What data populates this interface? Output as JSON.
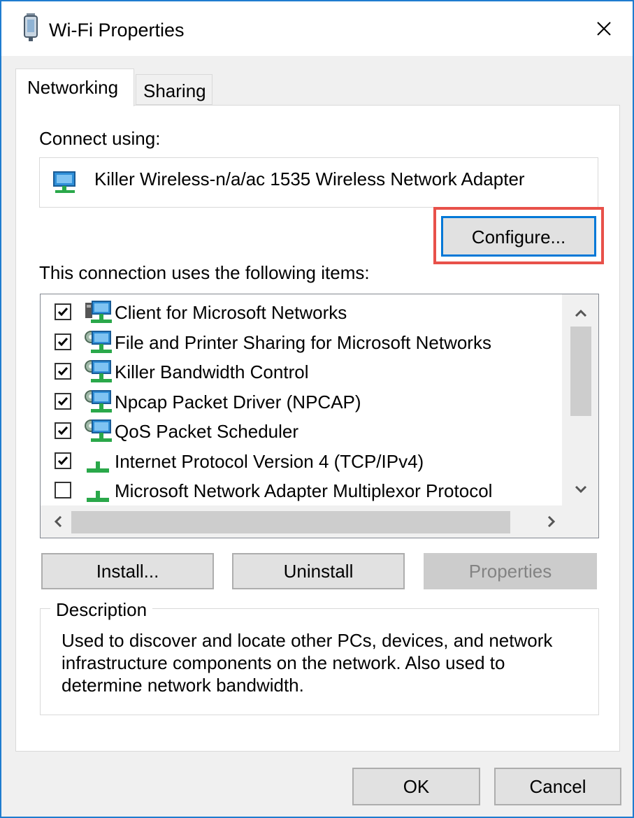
{
  "window": {
    "title": "Wi-Fi Properties"
  },
  "tabs": [
    {
      "label": "Networking",
      "selected": true
    },
    {
      "label": "Sharing",
      "selected": false
    }
  ],
  "connect_using": {
    "label": "Connect using:",
    "adapter": "Killer Wireless-n/a/ac 1535 Wireless Network Adapter",
    "configure_label": "Configure..."
  },
  "items": {
    "label": "This connection uses the following items:",
    "list": [
      {
        "label": "Client for Microsoft Networks",
        "checked": true,
        "icon": "network-client-icon"
      },
      {
        "label": "File and Printer Sharing for Microsoft Networks",
        "checked": true,
        "icon": "network-service-icon"
      },
      {
        "label": "Killer Bandwidth Control",
        "checked": true,
        "icon": "network-service-icon"
      },
      {
        "label": "Npcap Packet Driver (NPCAP)",
        "checked": true,
        "icon": "network-service-icon"
      },
      {
        "label": "QoS Packet Scheduler",
        "checked": true,
        "icon": "network-service-icon"
      },
      {
        "label": "Internet Protocol Version 4 (TCP/IPv4)",
        "checked": true,
        "icon": "protocol-icon"
      },
      {
        "label": "Microsoft Network Adapter Multiplexor Protocol",
        "checked": false,
        "icon": "protocol-icon"
      }
    ]
  },
  "buttons": {
    "install": "Install...",
    "uninstall": "Uninstall",
    "properties": "Properties",
    "ok": "OK",
    "cancel": "Cancel"
  },
  "description": {
    "legend": "Description",
    "text": "Used to discover and locate other PCs, devices, and network infrastructure components on the network.  Also used to determine network bandwidth."
  },
  "colors": {
    "accent": "#0078d7",
    "highlight": "#e8514a",
    "window_border": "#1f7ccf"
  }
}
